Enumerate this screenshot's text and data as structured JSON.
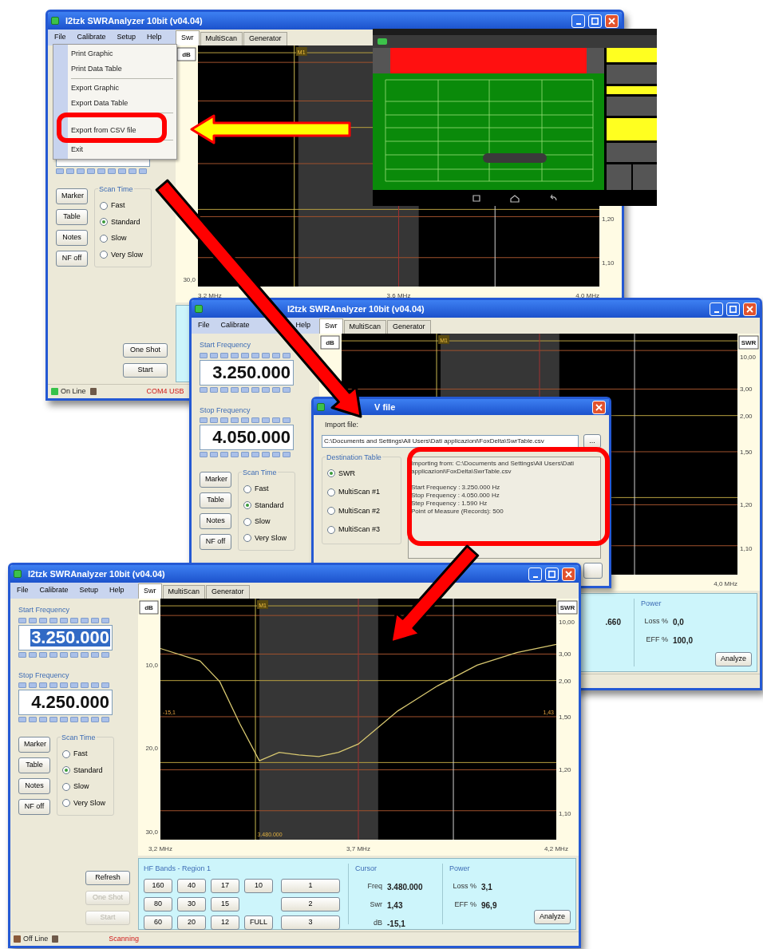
{
  "windows": [
    {
      "title": "I2tzk SWRAnalyzer 10bit (v04.04)",
      "menu": [
        "File",
        "Calibrate",
        "Setup",
        "Help"
      ],
      "tabs": [
        {
          "label": "Swr",
          "selected": true
        },
        {
          "label": "MultiScan",
          "selected": false
        },
        {
          "label": "Generator",
          "selected": false
        }
      ],
      "file_menu": [
        [
          "Print Graphic",
          "Print Data Table"
        ],
        [
          "Export Graphic",
          "Export Data Table"
        ],
        [
          "Export from CSV file"
        ],
        [
          "Exit"
        ]
      ],
      "side_buttons": [
        "Marker",
        "Table",
        "Notes",
        "NF off"
      ],
      "scan_time": {
        "label": "Scan Time",
        "options": [
          {
            "label": "Fast",
            "selected": false
          },
          {
            "label": "Standard",
            "selected": true
          },
          {
            "label": "Slow",
            "selected": false
          },
          {
            "label": "Very Slow",
            "selected": false
          }
        ]
      },
      "action_buttons": [
        {
          "label": "One Shot",
          "disabled": false
        },
        {
          "label": "Start",
          "disabled": false
        }
      ],
      "chart": {
        "left_title": "dB",
        "marker": "M1",
        "left_labels": [
          "30,0"
        ],
        "right_labels": [
          "1,20",
          "1,10"
        ],
        "x_labels": [
          "3,2 MHz",
          "3,6 MHz",
          "4,0 MHz"
        ]
      },
      "status": {
        "connection": "On Line",
        "online": true,
        "message": "COM4 USB"
      }
    },
    {
      "title": "I2tzk SWRAnalyzer 10bit (v04.04)",
      "menu": [
        "File",
        "Calibrate",
        "Help"
      ],
      "tabs": [
        {
          "label": "Swr",
          "selected": true
        },
        {
          "label": "MultiScan",
          "selected": false
        },
        {
          "label": "Generator",
          "selected": false
        }
      ],
      "start_frequency": {
        "label": "Start Frequency",
        "value": "3.250.000",
        "selected": false
      },
      "stop_frequency": {
        "label": "Stop Frequency",
        "value": "4.050.000",
        "selected": false
      },
      "side_buttons": [
        "Marker",
        "Table",
        "Notes",
        "NF off"
      ],
      "scan_time": {
        "label": "Scan Time",
        "options": [
          {
            "label": "Fast",
            "selected": false
          },
          {
            "label": "Standard",
            "selected": true
          },
          {
            "label": "Slow",
            "selected": false
          },
          {
            "label": "Very Slow",
            "selected": false
          }
        ]
      },
      "chart": {
        "left_title": "dB",
        "right_title": "SWR",
        "marker": "M1",
        "right_labels": [
          "10,00",
          "3,00",
          "2,00",
          "1,50",
          "1,20",
          "1,10"
        ],
        "x_labels": [
          "4,0 MHz"
        ]
      },
      "bottom_panel": {
        "cursor_value": ".660",
        "power": {
          "label": "Power",
          "rows": [
            {
              "label": "Loss %",
              "value": "0,0"
            },
            {
              "label": "EFF %",
              "value": "100,0"
            }
          ]
        },
        "analyze_button": "Analyze"
      }
    },
    {
      "title": "I2tzk SWRAnalyzer 10bit (v04.04)",
      "menu": [
        "File",
        "Calibrate",
        "Setup",
        "Help"
      ],
      "tabs": [
        {
          "label": "Swr",
          "selected": true
        },
        {
          "label": "MultiScan",
          "selected": false
        },
        {
          "label": "Generator",
          "selected": false
        }
      ],
      "start_frequency": {
        "label": "Start Frequency",
        "value": "3.250.000",
        "selected": true
      },
      "stop_frequency": {
        "label": "Stop Frequency",
        "value": "4.250.000",
        "selected": false
      },
      "side_buttons": [
        "Marker",
        "Table",
        "Notes",
        "NF off"
      ],
      "scan_time": {
        "label": "Scan Time",
        "options": [
          {
            "label": "Fast",
            "selected": false
          },
          {
            "label": "Standard",
            "selected": true
          },
          {
            "label": "Slow",
            "selected": false
          },
          {
            "label": "Very Slow",
            "selected": false
          }
        ]
      },
      "action_buttons": [
        {
          "label": "Refresh",
          "disabled": false
        },
        {
          "label": "One Shot",
          "disabled": true
        },
        {
          "label": "Start",
          "disabled": true
        }
      ],
      "chart": {
        "left_title": "dB",
        "right_title": "SWR",
        "marker": "M1",
        "right_labels": [
          "10,00",
          "3,00",
          "2,00",
          "1,50",
          "1,20",
          "1,10"
        ],
        "cursor_label": "3.480.000",
        "left_value": "-15,1",
        "right_value": "1,43",
        "chart_data": {
          "type": "line",
          "x": [
            3.2,
            3.3,
            3.35,
            3.4,
            3.45,
            3.5,
            3.55,
            3.6,
            3.65,
            3.7,
            3.8,
            3.9,
            4.0,
            4.1,
            4.2
          ],
          "series": [
            {
              "color": "#d8c870",
              "values": [
                8,
                9.5,
                12,
                17,
                21.5,
                20.5,
                20.8,
                21,
                20.5,
                19.5,
                15.5,
                12.5,
                10,
                8.5,
                7.5
              ]
            }
          ],
          "xlim": [
            3.2,
            4.2
          ],
          "ylim": [
            31,
            2
          ],
          "bands": [
            {
              "axis": "x",
              "from": 3.45,
              "to": 3.75,
              "color": "#363636"
            }
          ],
          "ref_lines": [
            {
              "axis": "y",
              "value": 2.87,
              "color": "#b8a040"
            },
            {
              "axis": "y",
              "value": 4.03,
              "color": "#a0522d"
            },
            {
              "axis": "y",
              "value": 8.67,
              "color": "#a0522d"
            },
            {
              "axis": "y",
              "value": 11.86,
              "color": "#b8a040"
            },
            {
              "axis": "y",
              "value": 16.21,
              "color": "#a0522d"
            },
            {
              "axis": "y",
              "value": 21.72,
              "color": "#b8a040"
            },
            {
              "axis": "y",
              "value": 22.59,
              "color": "#a0522d"
            },
            {
              "axis": "y",
              "value": 27.52,
              "color": "#a0522d"
            },
            {
              "axis": "x",
              "value": 3.44,
              "color": "#c8b850"
            },
            {
              "axis": "x",
              "value": 3.7,
              "color": "#a03030"
            },
            {
              "axis": "x",
              "value": 3.94,
              "color": "#d0d0d0"
            }
          ],
          "xticks": [
            {
              "value": 3.2,
              "label": "3,2 MHz"
            },
            {
              "value": 3.7,
              "label": "3,7 MHz"
            },
            {
              "value": 4.2,
              "label": "4,2 MHz"
            }
          ],
          "yticks": [
            {
              "value": 10,
              "label": "10,0"
            },
            {
              "value": 20,
              "label": "20,0"
            },
            {
              "value": 30,
              "label": "30,0"
            }
          ]
        }
      },
      "bottom_panel": {
        "bands": {
          "label": "HF Bands - Region 1",
          "rows": [
            [
              "160",
              "40",
              "17",
              "10"
            ],
            [
              "80",
              "30",
              "15"
            ],
            [
              "60",
              "20",
              "12",
              "FULL"
            ]
          ],
          "memory_buttons": [
            "1",
            "2",
            "3"
          ]
        },
        "cursor": {
          "label": "Cursor",
          "rows": [
            {
              "label": "Freq",
              "value": "3.480.000"
            },
            {
              "label": "Swr",
              "value": "1,43"
            },
            {
              "label": "dB",
              "value": "-15,1"
            }
          ]
        },
        "power": {
          "label": "Power",
          "rows": [
            {
              "label": "Loss %",
              "value": "3,1"
            },
            {
              "label": "EFF %",
              "value": "96,9"
            }
          ]
        },
        "analyze_button": "Analyze"
      },
      "status": {
        "connection": "Off Line",
        "online": false,
        "message": "Scanning"
      }
    }
  ],
  "import_dialog": {
    "title": "V file",
    "file_label": "Import file:",
    "file_path": "C:\\Documents and Settings\\All Users\\Dati applicazioni\\FoxDelta\\SwrTable.csv",
    "browse_button": "...",
    "destination": {
      "label": "Destination Table",
      "options": [
        {
          "label": "SWR",
          "selected": true
        },
        {
          "label": "MultiScan #1",
          "selected": false
        },
        {
          "label": "MultiScan #2",
          "selected": false
        },
        {
          "label": "MultiScan #3",
          "selected": false
        }
      ]
    },
    "log_lines": [
      "Importing from: C:\\Documents and Settings\\All Users\\Dati applicazioni\\FoxDelta\\SwrTable.csv",
      "Start Frequency : 3.250.000 Hz",
      "Stop Frequency : 4.050.000 Hz",
      "Step Frequency : 1.590 Hz",
      "Point of Measure (Records): 500"
    ]
  }
}
